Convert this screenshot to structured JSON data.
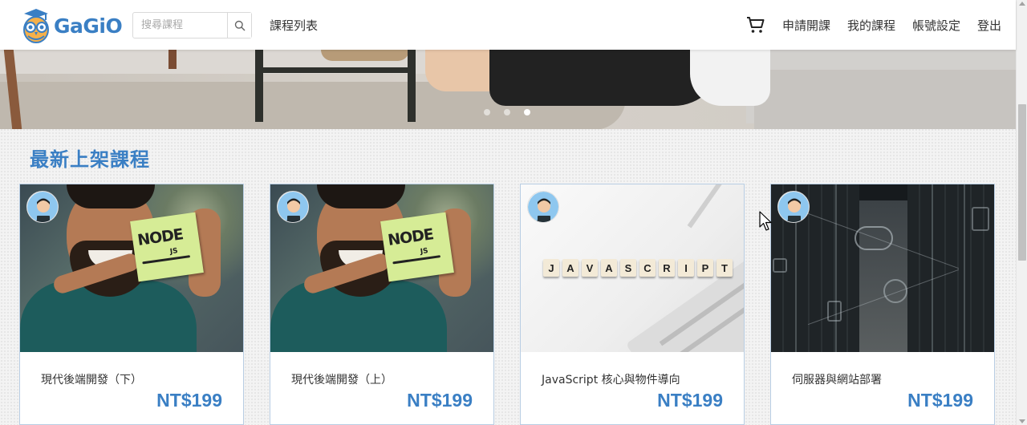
{
  "header": {
    "logo_text": "GaGiO",
    "search_placeholder": "搜尋課程",
    "nav_left": "課程列表",
    "nav_right": [
      "申請開課",
      "我的課程",
      "帳號設定",
      "登出"
    ]
  },
  "banner": {
    "carousel_dots": 3,
    "active_dot": 3
  },
  "section": {
    "title": "最新上架課程"
  },
  "courses": [
    {
      "title": "現代後端開發（下）",
      "price": "NT$199",
      "image": "nodejs"
    },
    {
      "title": "現代後端開發（上）",
      "price": "NT$199",
      "image": "nodejs"
    },
    {
      "title": "JavaScript 核心與物件導向",
      "price": "NT$199",
      "image": "javascript",
      "tiles": [
        "J",
        "A",
        "V",
        "A",
        "S",
        "C",
        "R",
        "I",
        "P",
        "T"
      ]
    },
    {
      "title": "伺服器與網站部署",
      "price": "NT$199",
      "image": "server"
    }
  ],
  "colors": {
    "brand": "#3a7fc4",
    "card_border": "#b8cde3",
    "text": "#333333"
  }
}
